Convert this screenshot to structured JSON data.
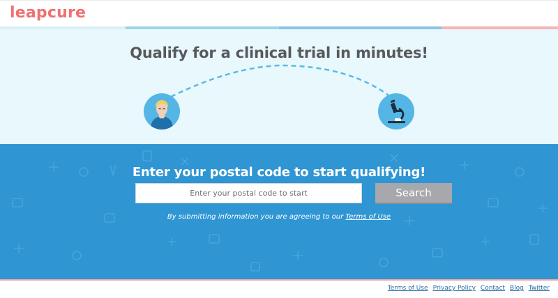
{
  "header": {
    "logo_text": "leapcure",
    "brand_color": "#ef7072"
  },
  "hero": {
    "title": "Qualify for a clinical trial in minutes!",
    "left_icon": "patient-icon",
    "right_icon": "microscope-icon"
  },
  "search": {
    "title": "Enter your postal code to start qualifying!",
    "placeholder": "Enter your postal code to start",
    "value": "",
    "button_label": "Search",
    "disclaimer_text": "By submitting information you are agreeing to our ",
    "terms_link": "Terms of Use",
    "band_color": "#2f95d3"
  },
  "footer": {
    "links": [
      "Terms of Use",
      "Privacy Policy",
      "Contact",
      "Blog",
      "Twitter"
    ]
  }
}
